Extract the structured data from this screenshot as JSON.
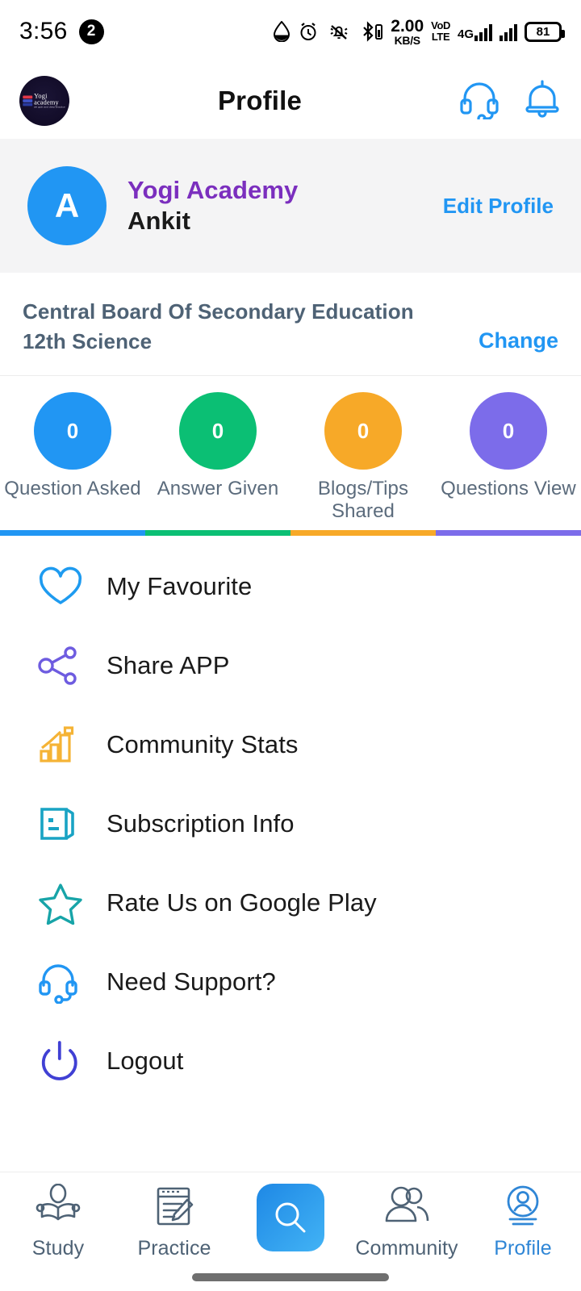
{
  "status_bar": {
    "time": "3:56",
    "notification_count": "2",
    "data_speed_value": "2.00",
    "data_speed_unit": "KB/S",
    "volte_line1": "VoD",
    "volte_line2": "LTE",
    "network_type": "4G",
    "battery_level": "81",
    "icons": [
      "water-drop-icon",
      "alarm-clock-icon",
      "bell-muted-icon",
      "bluetooth-icon",
      "signal-bars-icon",
      "battery-icon"
    ]
  },
  "header": {
    "title": "Profile",
    "logo_name": "Yogi",
    "logo_name2": "academy",
    "logo_tagline": "we gain and deep practice",
    "support_icon": "headset-icon",
    "notification_icon": "bell-icon"
  },
  "profile": {
    "avatar_initial": "A",
    "academy_name": "Yogi Academy",
    "user_name": "Ankit",
    "edit_label": "Edit Profile"
  },
  "board": {
    "board_name": "Central Board Of Secondary Education",
    "class_name": "12th Science",
    "change_label": "Change"
  },
  "stats": [
    {
      "value": "0",
      "label": "Question Asked",
      "color": "#2196f3"
    },
    {
      "value": "0",
      "label": "Answer Given",
      "color": "#0bbf74"
    },
    {
      "value": "0",
      "label": "Blogs/Tips Shared",
      "color": "#f7a928"
    },
    {
      "value": "0",
      "label": "Questions View",
      "color": "#7c6cea"
    }
  ],
  "menu": [
    {
      "label": "My Favourite",
      "icon": "heart-icon",
      "color": "#1e9bf0"
    },
    {
      "label": "Share APP",
      "icon": "share-nodes-icon",
      "color": "#6e5ce0"
    },
    {
      "label": "Community Stats",
      "icon": "bar-chart-icon",
      "color": "#f5b335"
    },
    {
      "label": "Subscription Info",
      "icon": "document-icon",
      "color": "#19a3c4"
    },
    {
      "label": "Rate Us on Google Play",
      "icon": "star-icon",
      "color": "#17a4a8"
    },
    {
      "label": "Need Support?",
      "icon": "headset-icon",
      "color": "#2196f3"
    },
    {
      "label": "Logout",
      "icon": "power-icon",
      "color": "#4040d4"
    }
  ],
  "bottom_nav": [
    {
      "label": "Study",
      "icon": "reading-person-icon",
      "active": false
    },
    {
      "label": "Practice",
      "icon": "notebook-pencil-icon",
      "active": false
    },
    {
      "label": "",
      "icon": "search-icon",
      "active": false
    },
    {
      "label": "Community",
      "icon": "people-icon",
      "active": false
    },
    {
      "label": "Profile",
      "icon": "user-circle-icon",
      "active": true
    }
  ],
  "colors": {
    "accent_blue": "#2196f3",
    "purple": "#7b2fbe",
    "slate": "#4e6275",
    "card_bg": "#f4f4f5"
  }
}
